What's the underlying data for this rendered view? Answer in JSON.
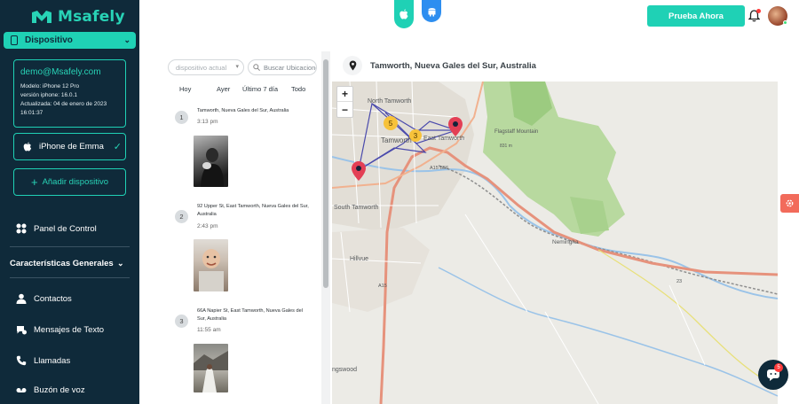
{
  "brand": {
    "name": "Msafely"
  },
  "sidebar": {
    "device_tab": "Dispositivo",
    "account": {
      "email": "demo@Msafely.com",
      "model": "Modelo: iPhone 12 Pro",
      "version": "versión iphone: 16.0.1",
      "updated": "Actualizada: 04 de enero de 2023",
      "time": "16:01:37"
    },
    "device_name": "iPhone de Emma",
    "add_device": "Añadir dispositivo",
    "control_panel": "Panel de Control",
    "section_title": "Características Generales",
    "items": [
      {
        "label": "Contactos",
        "icon": "contacts-icon"
      },
      {
        "label": "Mensajes de Texto",
        "icon": "messages-icon"
      },
      {
        "label": "Llamadas",
        "icon": "phone-icon"
      },
      {
        "label": "Buzón de voz",
        "icon": "voicemail-icon"
      }
    ]
  },
  "topbar": {
    "trial_button": "Prueba Ahora"
  },
  "locations": {
    "device_select_placeholder": "dispositivo actual",
    "search_placeholder": "Buscar Ubicaciones",
    "time_tabs": [
      "Hoy",
      "Ayer",
      "Último 7 día",
      "Todo"
    ],
    "entries": [
      {
        "num": "1",
        "address": "Tamworth, Nueva Gales del Sur, Australia",
        "time": "3:13 pm"
      },
      {
        "num": "2",
        "address": "92 Upper St, East Tamworth, Nueva Gales del Sur, Australia",
        "time": "2:43 pm"
      },
      {
        "num": "3",
        "address": "66A Napier St, East Tamworth, Nueva Gales del Sur, Australia",
        "time": "11:55 am"
      }
    ]
  },
  "map": {
    "title": "Tamworth, Nueva Gales del Sur, Australia",
    "zoom_in": "+",
    "zoom_out": "−",
    "labels": {
      "north": "North Tamworth",
      "town": "Tamworth",
      "east": "East Tamworth",
      "south": "South Tamworth",
      "hillvue": "Hillvue",
      "nemingha": "Nemingha",
      "westwood": "ngswood",
      "flagstaff": "Flagstaff Mountain",
      "flagstaff_m": "831 m",
      "a15": "A15",
      "b56": "B56",
      "a15b": "A15 B56",
      "r23": "23"
    },
    "clusters": [
      "5",
      "3"
    ],
    "colors": {
      "route": "#3a3aa8",
      "marker": "#e33f55",
      "cluster": "#f7c23a",
      "park": "#a7d18a"
    }
  },
  "chat": {
    "badge": "5"
  }
}
